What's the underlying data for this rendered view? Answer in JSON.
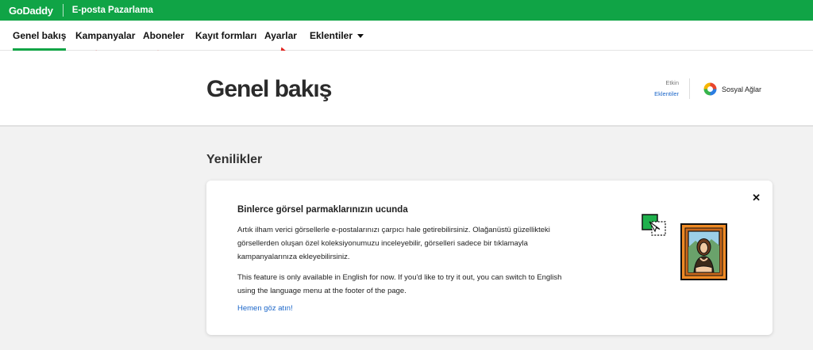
{
  "topbar": {
    "brand": "GoDaddy",
    "product": "E-posta Pazarlama",
    "color": "#10a446"
  },
  "nav": {
    "items": [
      {
        "label": "Genel bakış",
        "active": true
      },
      {
        "label": "Kampanyalar"
      },
      {
        "label": "Aboneler"
      },
      {
        "label": "Kayıt formları"
      },
      {
        "label": "Ayarlar"
      },
      {
        "label": "Eklentiler",
        "icon": "chevron-down-icon"
      }
    ]
  },
  "header": {
    "title": "Genel bakış",
    "active_label": "Etkin",
    "active_link": "Eklentiler",
    "social_label": "Sosyal Ağlar"
  },
  "main": {
    "section_title": "Yenilikler",
    "card": {
      "title": "Binlerce görsel parmaklarınızın ucunda",
      "paragraph1": "Artık ilham verici görsellerle e-postalarınızı çarpıcı hale getirebilirsiniz. Olağanüstü güzellikteki görsellerden oluşan özel koleksiyonumuzu inceleyebilir, görselleri sadece bir tıklamayla kampanyalarınıza ekleyebilirsiniz.",
      "paragraph2": "This feature is only available in English for now. If you'd like to try it out, you can switch to English using the language menu at the footer of the page.",
      "link": "Hemen göz atın!",
      "close_icon": "close-icon"
    }
  },
  "annotations": {
    "arrow_color": "#e0201b"
  }
}
